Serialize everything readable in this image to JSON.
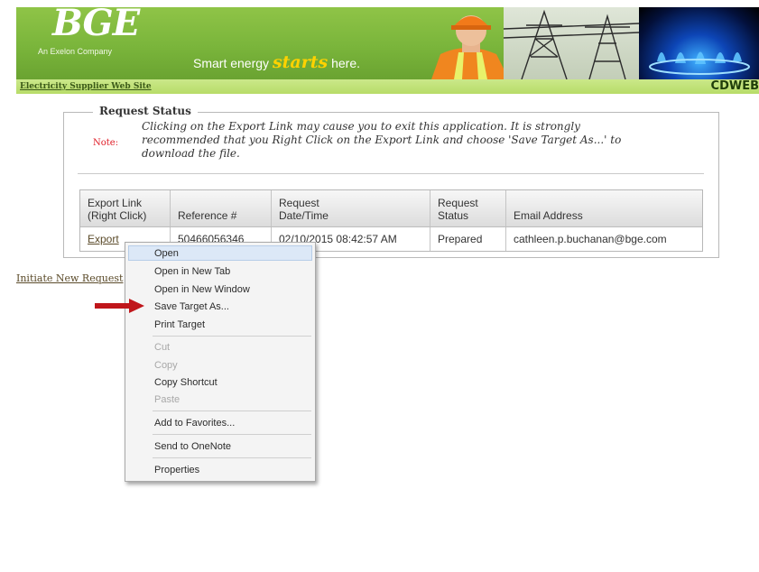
{
  "banner": {
    "logo": "BGE",
    "logo_sub": "An Exelon Company",
    "slogan_prefix": "Smart energy",
    "slogan_starts": "starts",
    "slogan_suffix": "here."
  },
  "subbar": {
    "site_link": "Electricity Supplier Web Site",
    "app_name": "CDWEB"
  },
  "request_status": {
    "legend": "Request Status",
    "note_label": "Note:",
    "note_text": "Clicking on the Export Link may cause you to exit this application. It is strongly recommended that you Right Click on the Export Link and choose 'Save Target As...' to download the file.",
    "headers": {
      "export": [
        "Export Link",
        "(Right Click)"
      ],
      "reference": "Reference #",
      "datetime": [
        "Request",
        "Date/Time"
      ],
      "status": [
        "Request",
        "Status"
      ],
      "email": "Email Address"
    },
    "row": {
      "export": "Export",
      "reference": "50466056346",
      "datetime": "02/10/2015 08:42:57 AM",
      "status": "Prepared",
      "email": "cathleen.p.buchanan@bge.com"
    }
  },
  "initiate_link": "Initiate New Request",
  "context_menu": {
    "items": [
      {
        "label": "Open",
        "enabled": true
      },
      {
        "label": "Open in New Tab",
        "enabled": true
      },
      {
        "label": "Open in New Window",
        "enabled": true
      },
      {
        "label": "Save Target As...",
        "enabled": true
      },
      {
        "label": "Print Target",
        "enabled": true
      },
      {
        "label": "Cut",
        "enabled": false
      },
      {
        "label": "Copy",
        "enabled": false
      },
      {
        "label": "Copy Shortcut",
        "enabled": true
      },
      {
        "label": "Paste",
        "enabled": false
      },
      {
        "label": "Add to Favorites...",
        "enabled": true
      },
      {
        "label": "Send to OneNote",
        "enabled": true
      },
      {
        "label": "Properties",
        "enabled": true
      }
    ]
  },
  "colors": {
    "banner_green": "#7ab53b",
    "note_red": "#e0202a",
    "arrow_red": "#c0161b",
    "slogan_yellow": "#ffd200"
  }
}
